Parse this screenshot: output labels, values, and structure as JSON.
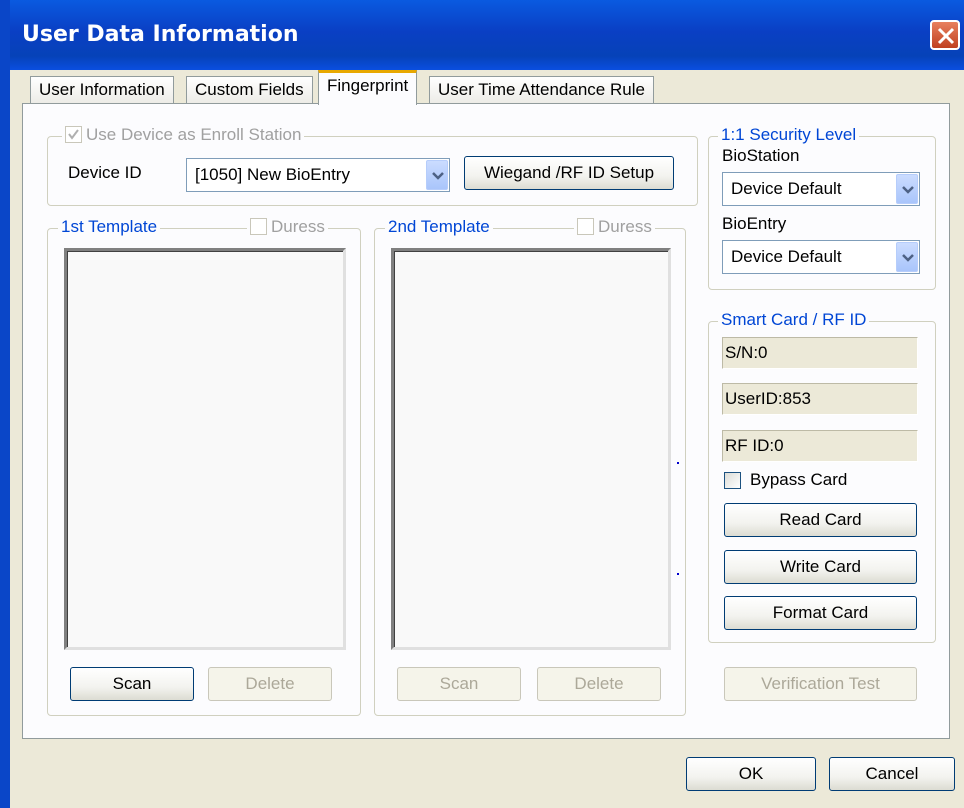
{
  "window": {
    "title": "User Data Information"
  },
  "tabs": [
    {
      "label": "User Information"
    },
    {
      "label": "Custom Fields"
    },
    {
      "label": "Fingerprint"
    },
    {
      "label": "User Time Attendance Rule"
    }
  ],
  "enroll": {
    "use_device_label": "Use Device as Enroll Station",
    "device_id_label": "Device ID",
    "device_id_value": "[1050] New BioEntry",
    "wiegand_button": "Wiegand /RF ID Setup"
  },
  "template1": {
    "legend": "1st Template",
    "duress_label": "Duress",
    "scan_button": "Scan",
    "delete_button": "Delete"
  },
  "template2": {
    "legend": "2nd Template",
    "duress_label": "Duress",
    "scan_button": "Scan",
    "delete_button": "Delete"
  },
  "security": {
    "legend": "1:1 Security Level",
    "biostation_label": "BioStation",
    "biostation_value": "Device Default",
    "bioentry_label": "BioEntry",
    "bioentry_value": "Device Default"
  },
  "smartcard": {
    "legend": "Smart Card / RF ID",
    "sn": "S/N:0",
    "userid": "UserID:853",
    "rfid": "RF ID:0",
    "bypass_label": "Bypass Card",
    "read_button": "Read Card",
    "write_button": "Write Card",
    "format_button": "Format Card"
  },
  "verification_button": "Verification Test",
  "footer": {
    "ok_button": "OK",
    "cancel_button": "Cancel"
  },
  "colors": {
    "titlebar": "#0a3fc4",
    "legend_blue": "#0046d5",
    "tab_highlight": "#e8a800",
    "close_red": "#c0401f"
  }
}
